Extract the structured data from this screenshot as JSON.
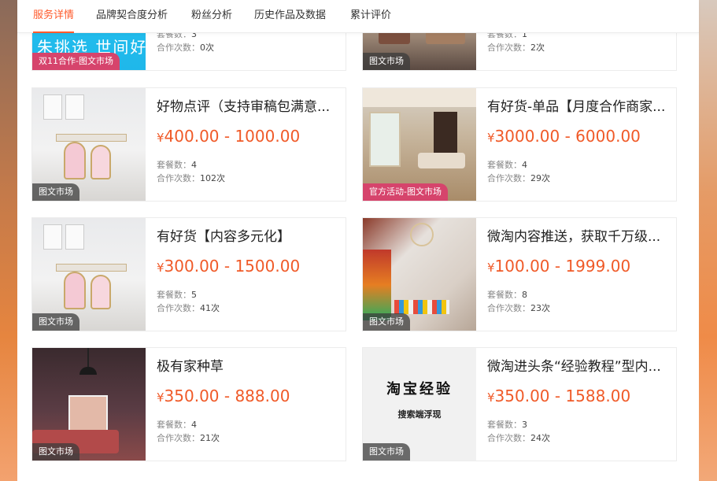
{
  "tabs": [
    {
      "label": "服务详情",
      "active": true
    },
    {
      "label": "品牌契合度分析",
      "active": false
    },
    {
      "label": "粉丝分析",
      "active": false
    },
    {
      "label": "历史作品及数据",
      "active": false
    },
    {
      "label": "累计评价",
      "active": false
    }
  ],
  "labels": {
    "package_count": "套餐数：",
    "collab_count": "合作次数：",
    "currency": "¥"
  },
  "cards": [
    {
      "title": "",
      "price": "",
      "packages": "3",
      "collabs": "0次",
      "tag": "双11合作-图文市场",
      "tag_style": "pink",
      "thumb_text": "朱挑选 世间好"
    },
    {
      "title": "",
      "price": "",
      "packages": "1",
      "collabs": "2次",
      "tag": "图文市场",
      "tag_style": "grey"
    },
    {
      "title": "好物点评（支持审稿包满意...",
      "price": "400.00 - 1000.00",
      "packages": "4",
      "collabs": "102次",
      "tag": "图文市场",
      "tag_style": "grey"
    },
    {
      "title": "有好货-单品【月度合作商家...",
      "price": "3000.00 - 6000.00",
      "packages": "4",
      "collabs": "29次",
      "tag": "官方活动-图文市场",
      "tag_style": "pink"
    },
    {
      "title": "有好货【内容多元化】",
      "price": "300.00 - 1500.00",
      "packages": "5",
      "collabs": "41次",
      "tag": "图文市场",
      "tag_style": "grey"
    },
    {
      "title": "微淘内容推送，获取千万级...",
      "price": "100.00 - 1999.00",
      "packages": "8",
      "collabs": "23次",
      "tag": "图文市场",
      "tag_style": "grey"
    },
    {
      "title": "极有家种草",
      "price": "350.00 - 888.00",
      "packages": "4",
      "collabs": "21次",
      "tag": "图文市场",
      "tag_style": "grey"
    },
    {
      "title": "微淘进头条“经验教程”型内...",
      "price": "350.00 - 1588.00",
      "packages": "3",
      "collabs": "24次",
      "tag": "图文市场",
      "tag_style": "grey",
      "thumb_title": "淘宝经验",
      "thumb_subtitle": "搜索端浮现"
    }
  ],
  "colors": {
    "accent": "#ff5a2b",
    "price": "#f05a28",
    "tag_pink": "#d6446c"
  }
}
